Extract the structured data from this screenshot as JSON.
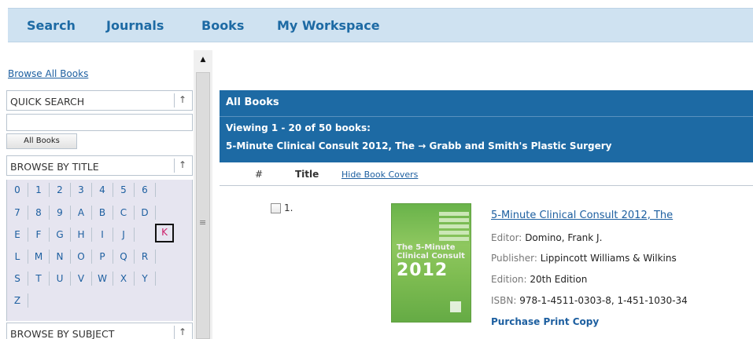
{
  "nav": {
    "items": [
      "Search",
      "Journals",
      "Books",
      "My Workspace"
    ]
  },
  "sidebar": {
    "browse_all": "Browse All Books",
    "quick_search": "QUICK SEARCH",
    "all_books_button": "All Books",
    "browse_by_title": "BROWSE BY TITLE",
    "browse_by_subject": "BROWSE BY SUBJECT",
    "collapse_arrow": "↑",
    "letters": [
      "0",
      "1",
      "2",
      "3",
      "4",
      "5",
      "6",
      "7",
      "8",
      "9",
      "A",
      "B",
      "C",
      "D",
      "E",
      "F",
      "G",
      "H",
      "I",
      "J",
      "K",
      "L",
      "M",
      "N",
      "O",
      "P",
      "Q",
      "R",
      "S",
      "T",
      "U",
      "V",
      "W",
      "X",
      "Y",
      "Z"
    ],
    "selected_letter": "K"
  },
  "main": {
    "title": "All Books",
    "viewing": "Viewing 1 - 20 of 50 books:",
    "range_start": "5-Minute Clinical Consult 2012, The",
    "range_arrow": "→",
    "range_end": "Grabb and Smith's Plastic Surgery",
    "col_num": "#",
    "col_title": "Title",
    "hide_covers": "Hide Book Covers"
  },
  "book": {
    "num": "1.",
    "title": "5-Minute Clinical Consult 2012, The",
    "editor_label": "Editor:",
    "editor": "Domino, Frank J.",
    "publisher_label": "Publisher:",
    "publisher": "Lippincott Williams & Wilkins",
    "edition_label": "Edition:",
    "edition": "20th Edition",
    "isbn_label": "ISBN:",
    "isbn": "978-1-4511-0303-8, 1-451-1030-34",
    "purchase": "Purchase Print Copy",
    "cover_line1": "The 5-Minute",
    "cover_line2": "Clinical Consult",
    "cover_year": "2012"
  },
  "colors": {
    "header_blue": "#1d6aa4",
    "nav_bg": "#cfe2f1",
    "letters_bg": "#e6e5f0",
    "selected_letter": "#cc1f6a",
    "cover_green": "#7fbd52"
  }
}
